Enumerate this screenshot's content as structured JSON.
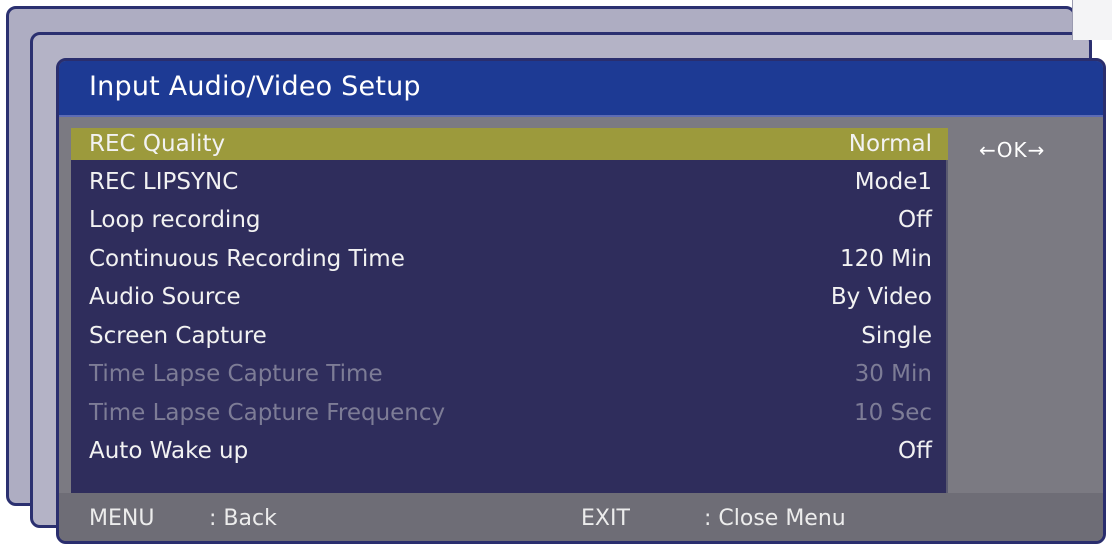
{
  "title": "Input Audio/Video Setup",
  "hint": "←OK→",
  "items": [
    {
      "label": "REC Quality",
      "value": "Normal"
    },
    {
      "label": "REC LIPSYNC",
      "value": "Mode1"
    },
    {
      "label": "Loop recording",
      "value": "Off"
    },
    {
      "label": "Continuous Recording Time",
      "value": "120 Min"
    },
    {
      "label": "Audio Source",
      "value": "By Video"
    },
    {
      "label": "Screen Capture",
      "value": "Single"
    },
    {
      "label": "Time Lapse Capture Time",
      "value": "30 Min"
    },
    {
      "label": "Time Lapse Capture Frequency",
      "value": "10 Sec"
    },
    {
      "label": "Auto Wake up",
      "value": "Off"
    }
  ],
  "footer": {
    "menu_key": "MENU",
    "menu_action": ": Back",
    "exit_key": "EXIT",
    "exit_action": ": Close Menu"
  },
  "colors": {
    "title_bar": "#1d3a94",
    "list_bg": "#2f2d5c",
    "selected_row": "#9c9a3c",
    "disabled_text": "#7d7c96"
  }
}
